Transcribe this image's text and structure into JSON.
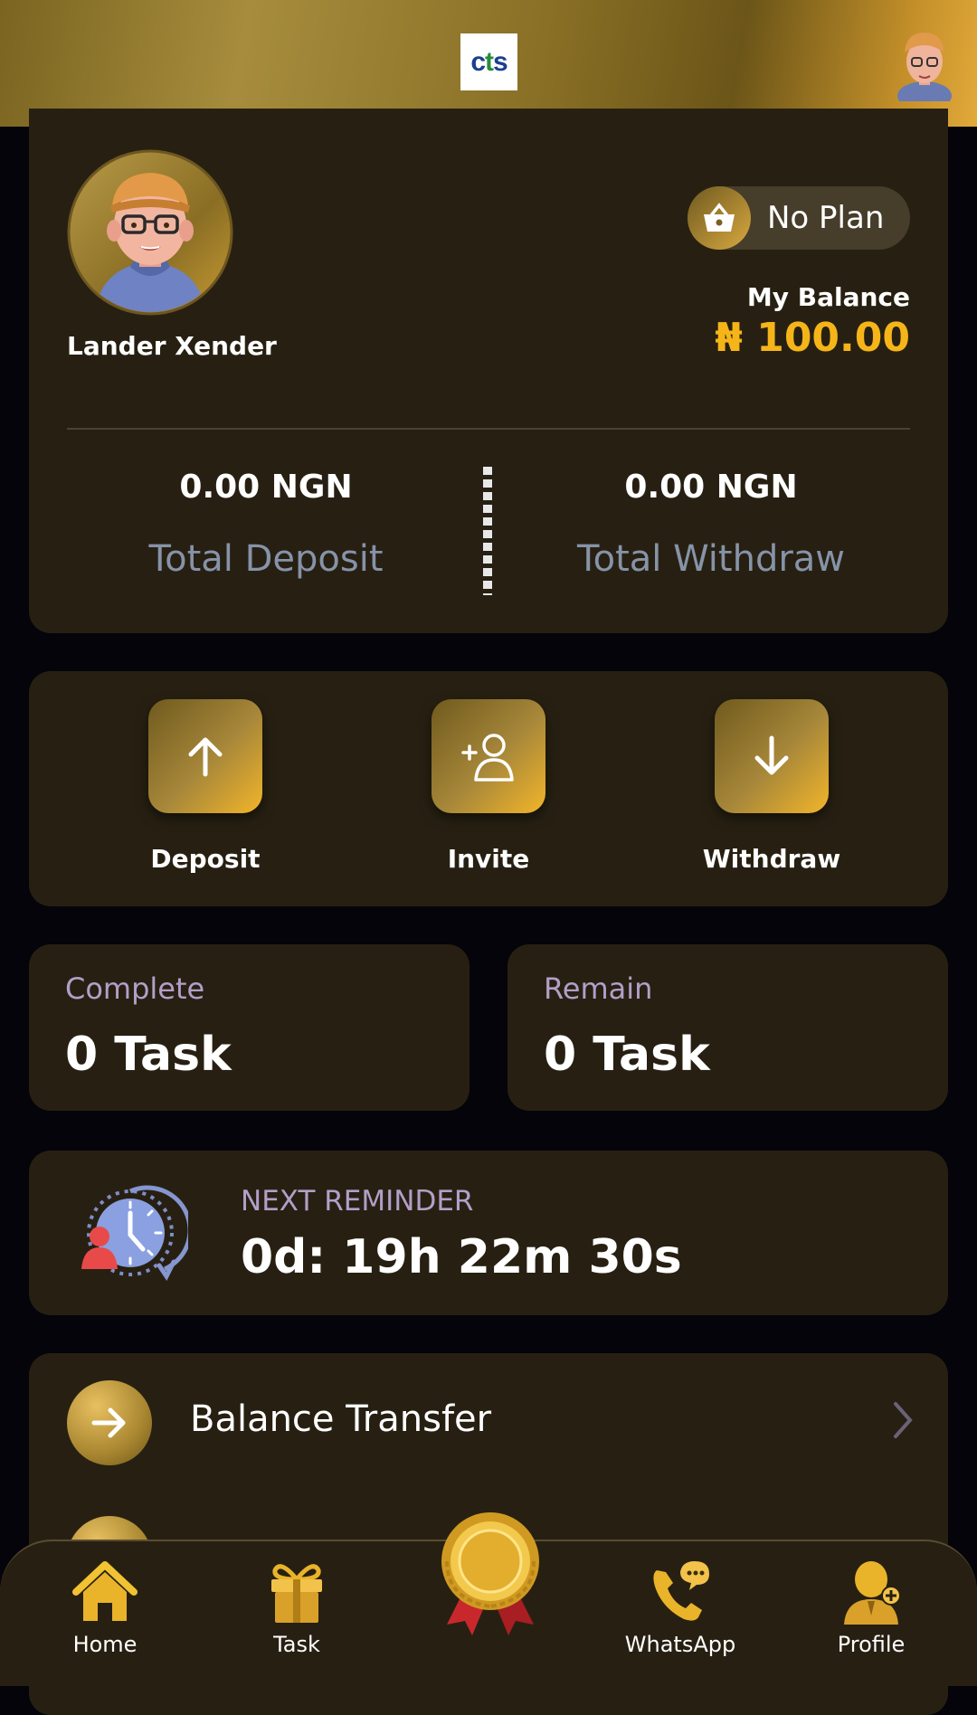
{
  "header": {
    "logo_text": [
      "c",
      "t",
      "s"
    ]
  },
  "profile": {
    "user_name": "Lander Xender",
    "plan_label": "No Plan",
    "balance_label": "My Balance",
    "balance_value": "₦ 100.00",
    "deposit_total_value": "0.00 NGN",
    "deposit_total_label": "Total Deposit",
    "withdraw_total_value": "0.00 NGN",
    "withdraw_total_label": "Total Withdraw"
  },
  "actions": [
    {
      "label": "Deposit",
      "icon": "arrow-up-icon"
    },
    {
      "label": "Invite",
      "icon": "add-user-icon"
    },
    {
      "label": "Withdraw",
      "icon": "arrow-down-icon"
    }
  ],
  "tasks": {
    "complete_title": "Complete",
    "complete_value": "0 Task",
    "remain_title": "Remain",
    "remain_value": "0 Task"
  },
  "reminder": {
    "title": "NEXT REMINDER",
    "value": "0d: 19h 22m 30s"
  },
  "menu": [
    {
      "label": "Balance Transfer",
      "icon": "arrow-right-icon"
    }
  ],
  "bottom_nav": [
    {
      "label": "Home",
      "icon": "home-icon"
    },
    {
      "label": "Task",
      "icon": "gift-icon"
    },
    {
      "label": "",
      "icon": "medal-icon"
    },
    {
      "label": "WhatsApp",
      "icon": "whatsapp-icon"
    },
    {
      "label": "Profile",
      "icon": "profile-icon"
    }
  ],
  "colors": {
    "accent_gold": "#f5b519",
    "card_bg": "#272012",
    "page_bg": "#04040a",
    "muted_label": "#8693a8",
    "lavender_label": "#b49ec8"
  }
}
